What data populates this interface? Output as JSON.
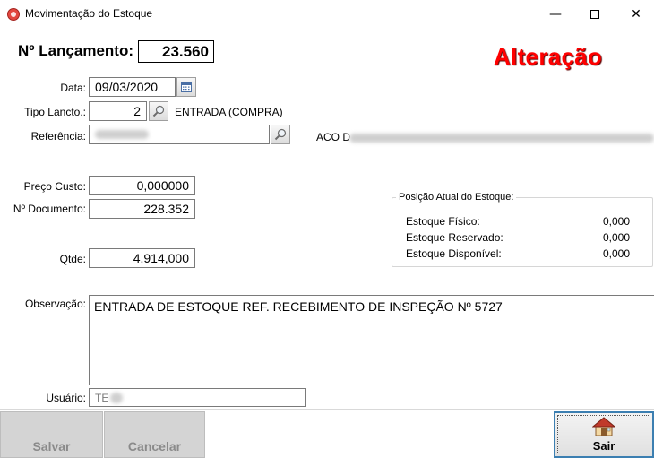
{
  "window": {
    "title": "Movimentação do Estoque",
    "minimize_glyph": "—",
    "close_glyph": "✕"
  },
  "header": {
    "lancamento_label": "Nº Lançamento:",
    "lancamento_value": "23.560",
    "mode_label": "Alteração"
  },
  "form": {
    "data_label": "Data:",
    "data_value": "09/03/2020",
    "tipo_label": "Tipo Lancto.:",
    "tipo_value": "2",
    "tipo_desc": "ENTRADA (COMPRA)",
    "referencia_label": "Referência:",
    "referencia_desc_prefix": "ACO D",
    "preco_label": "Preço Custo:",
    "preco_value": "0,000000",
    "documento_label": "Nº Documento:",
    "documento_value": "228.352",
    "qtde_label": "Qtde:",
    "qtde_value": "4.914,000",
    "observacao_label": "Observação:",
    "observacao_value": "ENTRADA DE ESTOQUE REF. RECEBIMENTO DE INSPEÇÃO Nº 5727",
    "usuario_label": "Usuário:",
    "usuario_value": "TE"
  },
  "stock": {
    "title": "Posição Atual do Estoque:",
    "rows": [
      {
        "label": "Estoque Físico:",
        "value": "0,000"
      },
      {
        "label": "Estoque Reservado:",
        "value": "0,000"
      },
      {
        "label": "Estoque Disponível:",
        "value": "0,000"
      }
    ]
  },
  "buttons": {
    "salvar": "Salvar",
    "cancelar": "Cancelar",
    "sair": "Sair"
  },
  "colors": {
    "mode_label": "#ff0000",
    "focus_border": "#3c7fb1",
    "disabled_button": "#d4d4d4"
  },
  "icons": {
    "app": "app-logo-icon",
    "calendar": "calendar-icon",
    "search": "magnifier-icon",
    "exit": "house-exit-icon"
  }
}
